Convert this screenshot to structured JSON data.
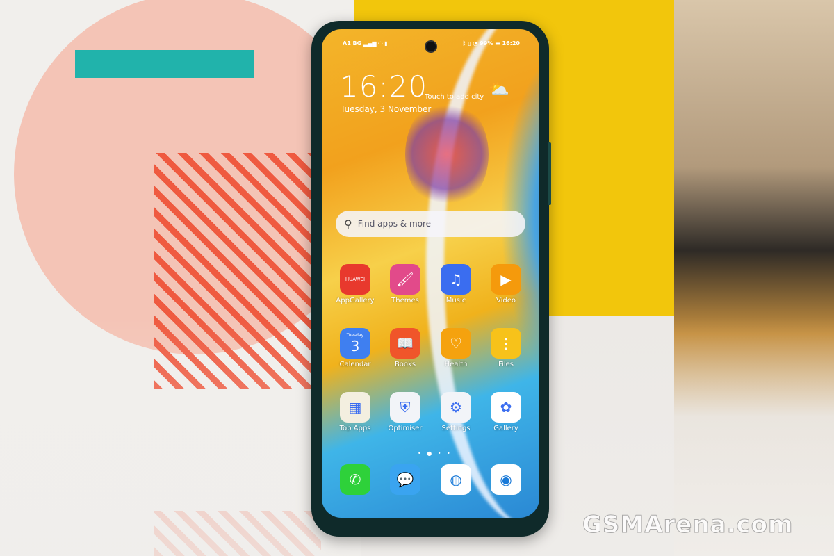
{
  "status": {
    "carrier": "A1 BG",
    "left_icons": "signal wifi battery-saver",
    "battery": "99%",
    "time": "16:20"
  },
  "clock": {
    "time": "16:20",
    "city": "Touch to add city",
    "date": "Tuesday, 3 November",
    "weather_icon": "partly-sunny-icon"
  },
  "search": {
    "placeholder": "Find apps & more"
  },
  "apps": [
    {
      "label": "AppGallery",
      "icon": "HUAWEI",
      "color": "#e8392d"
    },
    {
      "label": "Themes",
      "icon": "🖌",
      "color": "#e24a8a"
    },
    {
      "label": "Music",
      "icon": "♫",
      "color": "#3a6df0"
    },
    {
      "label": "Video",
      "icon": "▶",
      "color": "#f59a0c"
    },
    {
      "label": "Calendar",
      "icon": "3",
      "sub": "Tuesday",
      "color": "#3f7ff0"
    },
    {
      "label": "Books",
      "icon": "📖",
      "color": "#f0552a"
    },
    {
      "label": "Health",
      "icon": "♡",
      "color": "#f5a20e"
    },
    {
      "label": "Files",
      "icon": "⋮",
      "color": "#f7c21a"
    },
    {
      "label": "Top Apps",
      "icon": "▦",
      "color": "#f3efe0"
    },
    {
      "label": "Optimiser",
      "icon": "⛨",
      "color": "#f2f4f8"
    },
    {
      "label": "Settings",
      "icon": "⚙",
      "color": "#f2f4f8"
    },
    {
      "label": "Gallery",
      "icon": "✿",
      "color": "#ffffff"
    }
  ],
  "dock": [
    {
      "name": "phone",
      "icon": "✆",
      "color": "#2ed13a"
    },
    {
      "name": "messages",
      "icon": "💬",
      "color": "#3aa4f0"
    },
    {
      "name": "browser",
      "icon": "◍",
      "color": "#ffffff"
    },
    {
      "name": "camera",
      "icon": "◉",
      "color": "#ffffff"
    }
  ],
  "page_indicator": "• ● • •",
  "watermark": "GSMArena.com"
}
